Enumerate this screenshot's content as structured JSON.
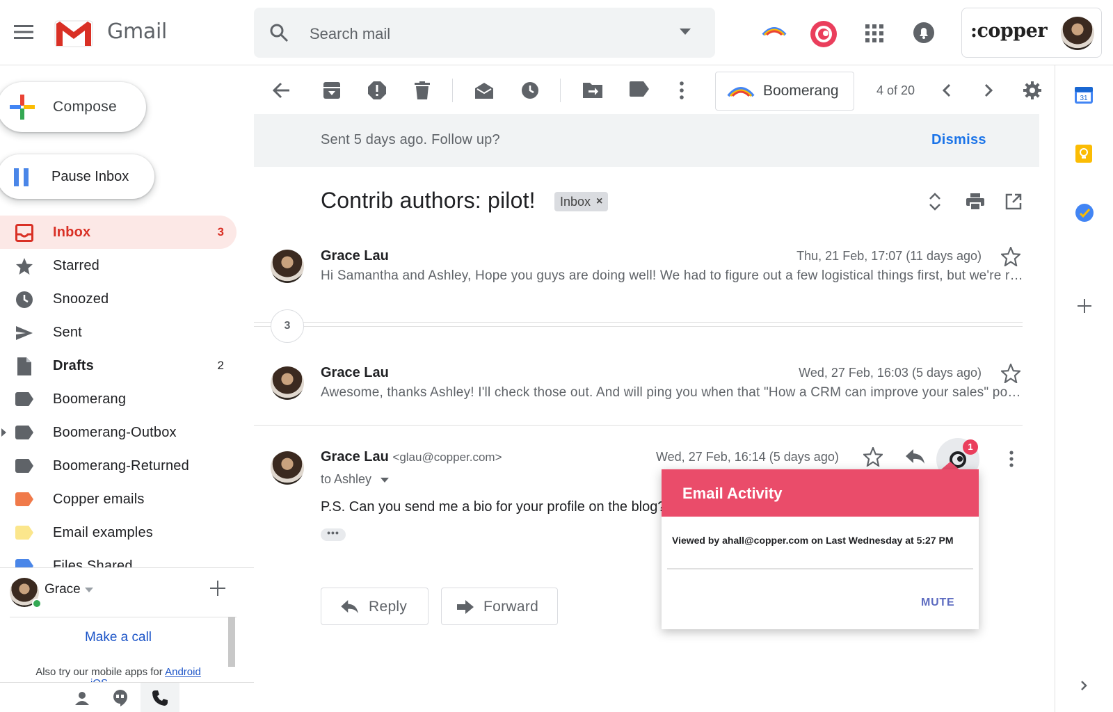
{
  "header": {
    "app_name": "Gmail",
    "search_placeholder": "Search mail",
    "account_brand": ":copper"
  },
  "nav": {
    "compose_label": "Compose",
    "pause_label": "Pause Inbox",
    "items": [
      {
        "label": "Inbox",
        "count": "3",
        "icon": "inbox-icon"
      },
      {
        "label": "Starred",
        "count": "",
        "icon": "star-icon"
      },
      {
        "label": "Snoozed",
        "count": "",
        "icon": "clock-icon"
      },
      {
        "label": "Sent",
        "count": "",
        "icon": "send-icon"
      },
      {
        "label": "Drafts",
        "count": "2",
        "icon": "draft-icon"
      },
      {
        "label": "Boomerang",
        "count": "",
        "icon": "label-icon"
      },
      {
        "label": "Boomerang-Outbox",
        "count": "",
        "icon": "label-icon"
      },
      {
        "label": "Boomerang-Returned",
        "count": "",
        "icon": "label-icon"
      },
      {
        "label": "Copper emails",
        "count": "",
        "icon": "label-icon",
        "color": "#f07a4a"
      },
      {
        "label": "Email examples",
        "count": "",
        "icon": "label-icon",
        "color": "#fbe68c"
      },
      {
        "label": "Files Shared",
        "count": "",
        "icon": "label-icon",
        "color": "#4a86e8"
      }
    ]
  },
  "hangouts": {
    "user_name": "Grace",
    "make_call": "Make a call",
    "mobile_prefix": "Also try our mobile apps for ",
    "mobile_link": "Android",
    "mobile_cut": "iOS"
  },
  "toolbar": {
    "boomerang_label": "Boomerang",
    "pager": "4 of 20"
  },
  "banner": {
    "text": "Sent 5 days ago. Follow up?",
    "dismiss": "Dismiss"
  },
  "thread": {
    "subject": "Contrib authors: pilot!",
    "chip": "Inbox",
    "collapsed_count": "3",
    "messages": [
      {
        "sender": "Grace Lau",
        "date": "Thu, 21 Feb, 17:07 (11 days ago)",
        "snippet": "Hi Samantha and Ashley, Hope you guys are doing well! We had to figure out a few logistical things first, but we're ready to start the pilot"
      },
      {
        "sender": "Grace Lau",
        "date": "Wed, 27 Feb, 16:03 (5 days ago)",
        "snippet": "Awesome, thanks Ashley! I'll check those out. And will ping you when that \"How a CRM can improve your sales\" post goes live"
      },
      {
        "sender": "Grace Lau",
        "email": "<glau@copper.com>",
        "date": "Wed, 27 Feb, 16:14 (5 days ago)",
        "to": "to Ashley",
        "body": "P.S. Can you send me a bio for your profile on the blog?"
      }
    ],
    "reply_label": "Reply",
    "forward_label": "Forward"
  },
  "activity_popup": {
    "badge": "1",
    "title": "Email Activity",
    "text": "Viewed by ahall@copper.com on Last Wednesday at 5:27 PM",
    "mute": "MUTE"
  },
  "side_panel": {
    "calendar_day": "31"
  },
  "colors": {
    "accent_red": "#d93025",
    "link_blue": "#1a73e8",
    "copper_pink": "#ea4c6a"
  }
}
